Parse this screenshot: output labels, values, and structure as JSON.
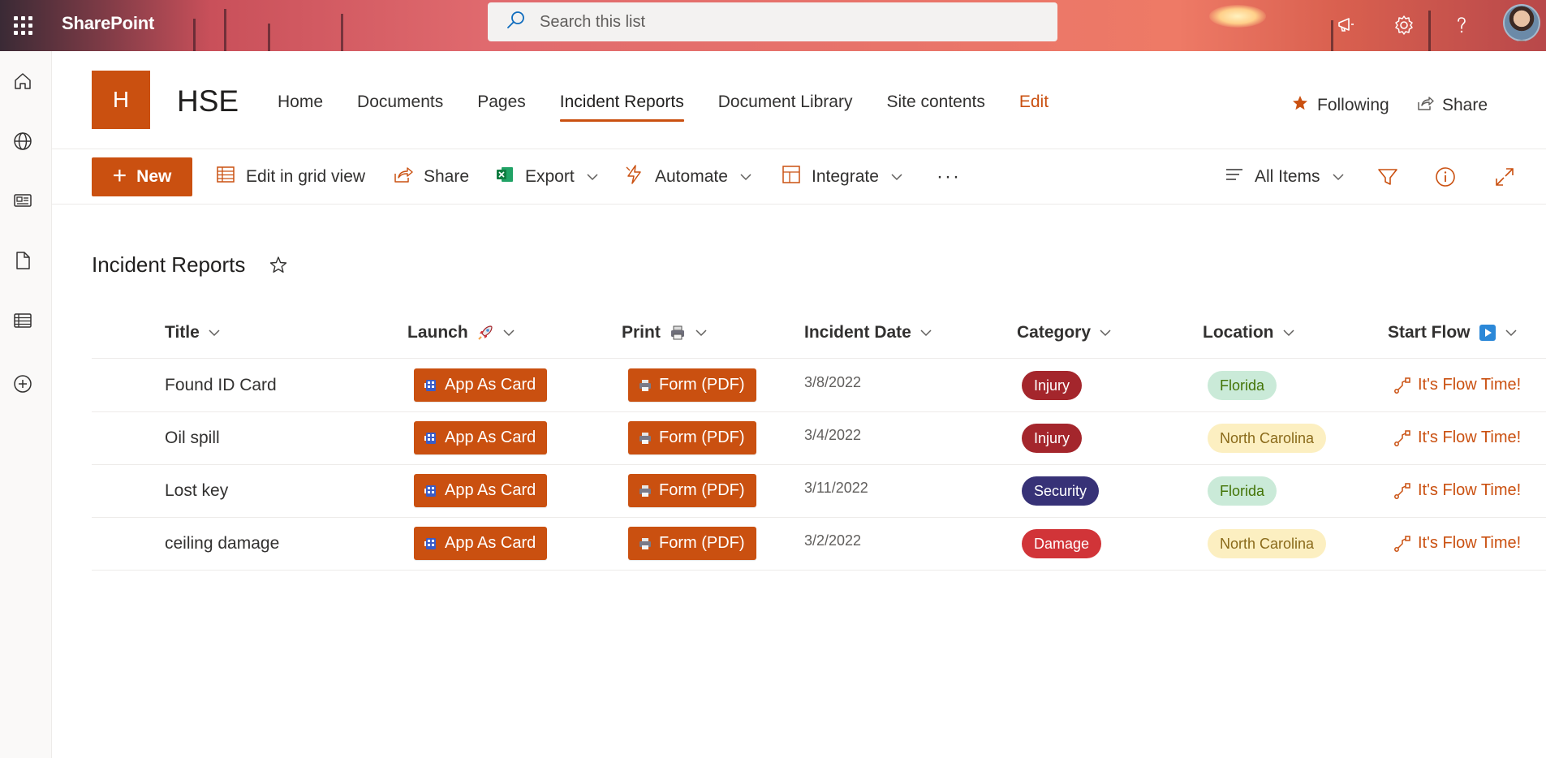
{
  "suite_bar": {
    "app_name": "SharePoint",
    "search_placeholder": "Search this list"
  },
  "site": {
    "logo_letter": "H",
    "title": "HSE",
    "nav": [
      {
        "label": "Home"
      },
      {
        "label": "Documents"
      },
      {
        "label": "Pages"
      },
      {
        "label": "Incident Reports",
        "active": true
      },
      {
        "label": "Document Library"
      },
      {
        "label": "Site contents"
      },
      {
        "label": "Edit"
      }
    ],
    "following_label": "Following",
    "share_label": "Share"
  },
  "command_bar": {
    "new_label": "New",
    "edit_grid_label": "Edit in grid view",
    "share_label": "Share",
    "export_label": "Export",
    "automate_label": "Automate",
    "integrate_label": "Integrate",
    "more_label": "···",
    "view_label": "All Items"
  },
  "list": {
    "title": "Incident Reports",
    "columns": [
      "Title",
      "Launch",
      "Print",
      "Incident Date",
      "Category",
      "Location",
      "Start Flow"
    ],
    "launch_button_label": "App As Card",
    "print_button_label": "Form (PDF)",
    "flow_link_label": "It's Flow Time!",
    "rows": [
      {
        "title": "Found ID Card",
        "date": "3/8/2022",
        "category": "Injury",
        "location": "Florida"
      },
      {
        "title": "Oil spill",
        "date": "3/4/2022",
        "category": "Injury",
        "location": "North Carolina"
      },
      {
        "title": "Lost key",
        "date": "3/11/2022",
        "category": "Security",
        "location": "Florida"
      },
      {
        "title": "ceiling damage",
        "date": "3/2/2022",
        "category": "Damage",
        "location": "North Carolina"
      }
    ]
  },
  "colors": {
    "accent": "#ca5010",
    "injury": "#a4262c",
    "security": "#373277",
    "damage": "#d13438",
    "florida_bg": "#caead8",
    "florida_fg": "#437406",
    "nc_bg": "#fcefc1",
    "nc_fg": "#8a6a1a"
  }
}
